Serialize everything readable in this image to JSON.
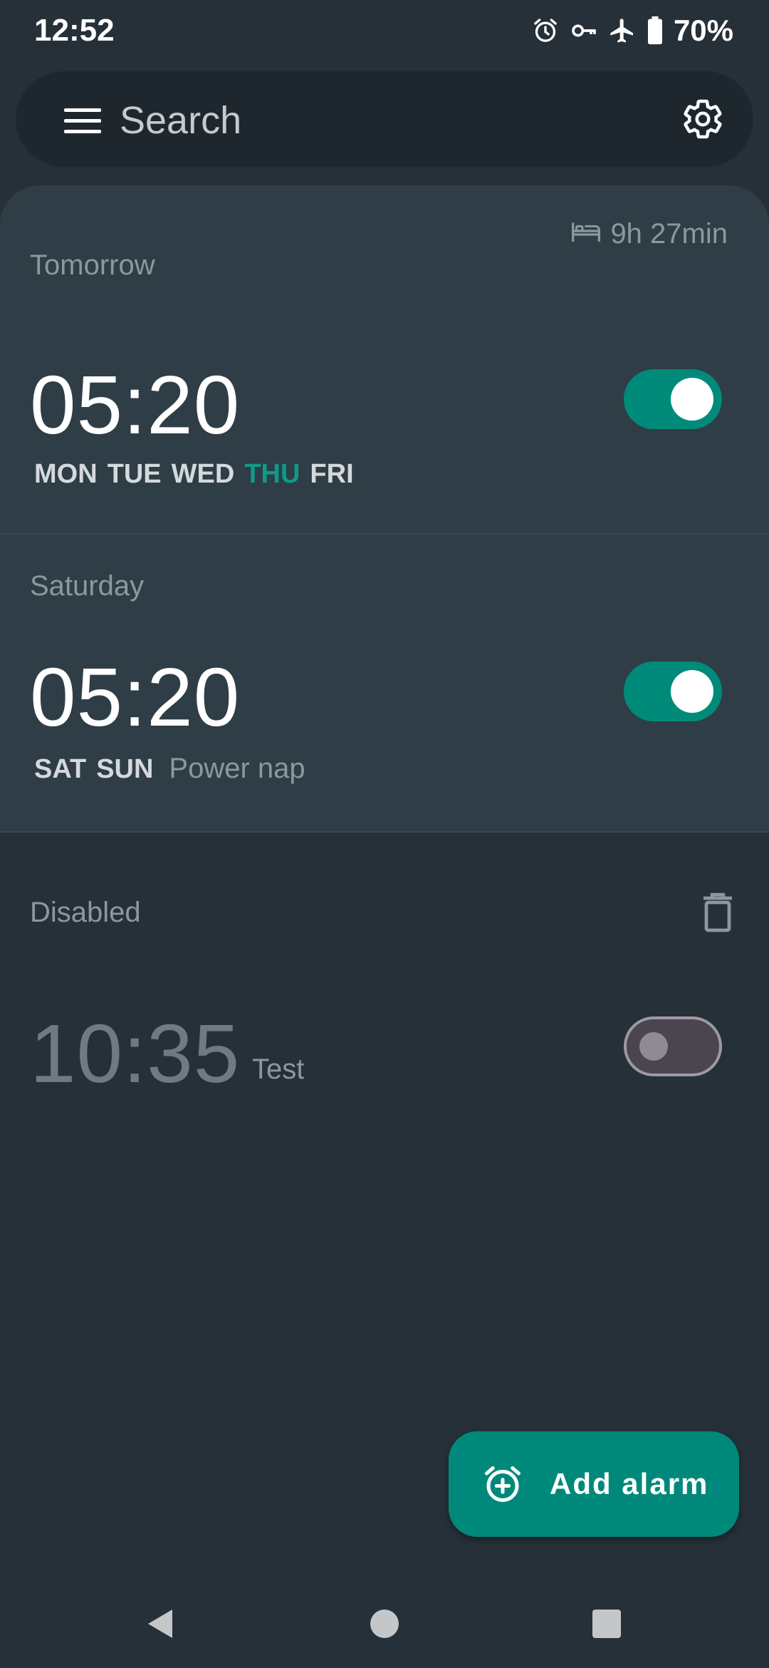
{
  "status_bar": {
    "time": "12:52",
    "icons": [
      "alarm-icon",
      "vpn-key-icon",
      "airplane-icon",
      "battery-icon"
    ],
    "battery": "70%"
  },
  "search": {
    "placeholder": "Search",
    "menu_icon": "menu-icon",
    "settings_icon": "settings-icon"
  },
  "enabled": {
    "sleep_duration": "9h 27min",
    "alarms": [
      {
        "section": "Tomorrow",
        "time": "05:20",
        "days": [
          "MON",
          "TUE",
          "WED",
          "THU",
          "FRI"
        ],
        "highlight_day": "THU",
        "label": "",
        "enabled": true
      },
      {
        "section": "Saturday",
        "time": "05:20",
        "days": [
          "SAT",
          "SUN"
        ],
        "label": "Power nap",
        "enabled": true
      }
    ]
  },
  "disabled": {
    "section": "Disabled",
    "alarms": [
      {
        "time": "10:35",
        "label": "Test",
        "enabled": false
      }
    ]
  },
  "fab": {
    "label": "Add alarm",
    "icon": "alarm-add-icon"
  },
  "colors": {
    "accent": "#00897b",
    "highlight_day": "#0f9a89",
    "background": "#263038",
    "card": "#2f3d46"
  }
}
